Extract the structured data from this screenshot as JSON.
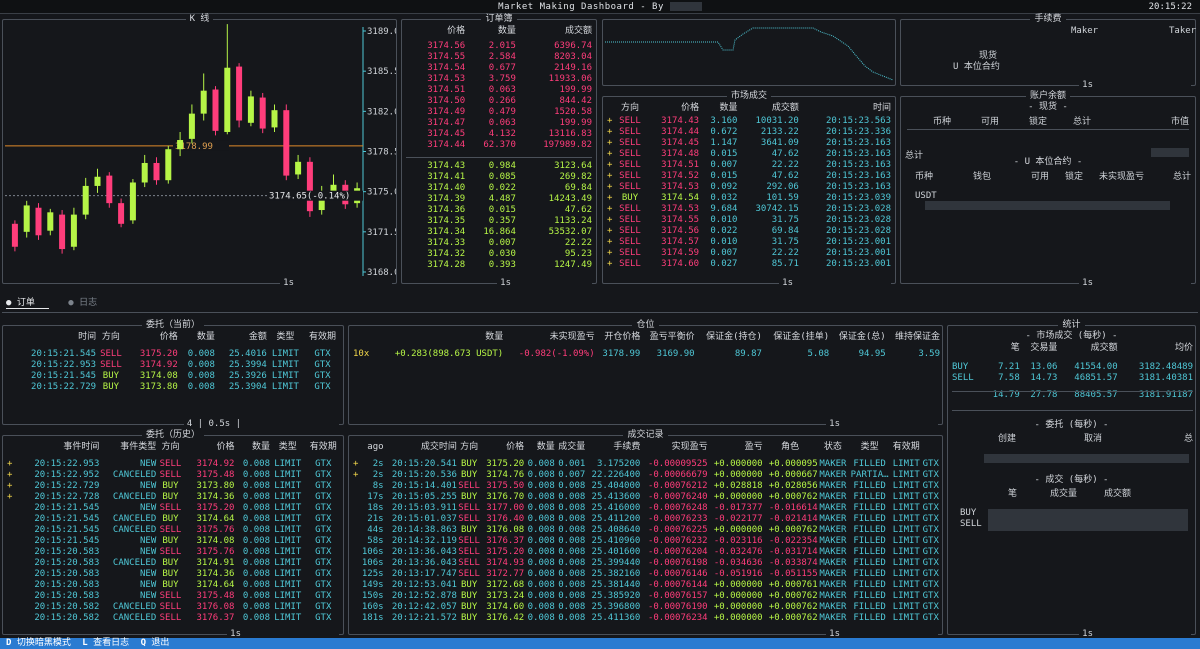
{
  "topbar": {
    "title": "Market Making Dashboard - By",
    "time": "20:15:22"
  },
  "kline": {
    "title": "K 线",
    "axis": [
      "3189.0",
      "3185.5",
      "3182.0",
      "3178.5",
      "3175.0",
      "3171.5",
      "3168.0"
    ],
    "hline_label": "3178.99",
    "last_label": "3174.65(-0.14%)",
    "interval": "1s",
    "ymin": 3168.0,
    "ymax": 3189.0,
    "candles": [
      [
        3172.2,
        3170.2,
        3172.5,
        3169.8
      ],
      [
        3171.5,
        3173.8,
        3174.2,
        3171.0
      ],
      [
        3173.6,
        3171.2,
        3174.0,
        3170.8
      ],
      [
        3171.6,
        3173.2,
        3173.5,
        3171.2
      ],
      [
        3173.0,
        3170.0,
        3173.4,
        3169.6
      ],
      [
        3170.2,
        3173.0,
        3173.6,
        3169.9
      ],
      [
        3173.0,
        3175.5,
        3176.2,
        3172.6
      ],
      [
        3175.5,
        3176.3,
        3177.0,
        3174.9
      ],
      [
        3176.4,
        3174.0,
        3176.7,
        3173.6
      ],
      [
        3174.0,
        3172.2,
        3174.4,
        3171.9
      ],
      [
        3172.5,
        3175.8,
        3176.1,
        3172.2
      ],
      [
        3175.8,
        3177.5,
        3178.2,
        3175.4
      ],
      [
        3177.5,
        3176.0,
        3178.0,
        3175.6
      ],
      [
        3176.0,
        3178.7,
        3179.0,
        3175.7
      ],
      [
        3178.7,
        3179.5,
        3180.2,
        3178.1
      ],
      [
        3179.6,
        3181.8,
        3182.6,
        3179.2
      ],
      [
        3181.8,
        3183.8,
        3185.3,
        3181.2
      ],
      [
        3183.9,
        3180.3,
        3184.2,
        3179.9
      ],
      [
        3180.2,
        3185.8,
        3189.6,
        3180.0
      ],
      [
        3185.9,
        3181.2,
        3186.2,
        3180.6
      ],
      [
        3181.0,
        3183.3,
        3183.8,
        3180.7
      ],
      [
        3183.2,
        3180.5,
        3183.6,
        3180.1
      ],
      [
        3180.6,
        3182.1,
        3182.6,
        3180.2
      ],
      [
        3182.1,
        3176.4,
        3182.6,
        3176.0
      ],
      [
        3176.5,
        3177.6,
        3178.2,
        3176.1
      ],
      [
        3177.6,
        3173.3,
        3178.0,
        3172.8
      ],
      [
        3173.4,
        3174.9,
        3175.5,
        3173.0
      ],
      [
        3174.9,
        3175.6,
        3176.5,
        3174.4
      ],
      [
        3175.6,
        3173.9,
        3176.0,
        3173.5
      ],
      [
        3174.0,
        3175.3,
        3175.8,
        3173.6
      ]
    ]
  },
  "orderbook": {
    "title": "订单簿",
    "headers": [
      "价格",
      "数量",
      "成交额"
    ],
    "asks": [
      [
        "3174.56",
        "2.015",
        "6396.74"
      ],
      [
        "3174.55",
        "2.584",
        "8203.04"
      ],
      [
        "3174.54",
        "0.677",
        "2149.16"
      ],
      [
        "3174.53",
        "3.759",
        "11933.06"
      ],
      [
        "3174.51",
        "0.063",
        "199.99"
      ],
      [
        "3174.50",
        "0.266",
        "844.42"
      ],
      [
        "3174.49",
        "0.479",
        "1520.58"
      ],
      [
        "3174.47",
        "0.063",
        "199.99"
      ],
      [
        "3174.45",
        "4.132",
        "13116.83"
      ],
      [
        "3174.44",
        "62.370",
        "197989.82"
      ]
    ],
    "bids": [
      [
        "3174.43",
        "0.984",
        "3123.64"
      ],
      [
        "3174.41",
        "0.085",
        "269.82"
      ],
      [
        "3174.40",
        "0.022",
        "69.84"
      ],
      [
        "3174.39",
        "4.487",
        "14243.49"
      ],
      [
        "3174.36",
        "0.015",
        "47.62"
      ],
      [
        "3174.35",
        "0.357",
        "1133.24"
      ],
      [
        "3174.34",
        "16.864",
        "53532.07"
      ],
      [
        "3174.33",
        "0.007",
        "22.22"
      ],
      [
        "3174.32",
        "0.030",
        "95.23"
      ],
      [
        "3174.28",
        "0.393",
        "1247.49"
      ]
    ],
    "interval": "1s"
  },
  "spark": {
    "values": [
      3174.65,
      3174.65,
      3174.65,
      3174.65,
      3174.65,
      3174.65,
      3174.65,
      3174.65,
      3174.65,
      3174.65,
      3174.65,
      3174.65,
      3174.65,
      3174.65,
      3174.65,
      3174.65,
      3174.65,
      3174.65,
      3174.65,
      3174.65,
      3174.65,
      3174.65,
      3174.65,
      3174.65,
      3174.65,
      3174.65,
      3174.65,
      3174.65,
      3174.65,
      3174.65,
      3174.65,
      3174.65,
      3174.65,
      3174.65,
      3174.65,
      3174.65,
      3174.65,
      3174.65,
      3174.65,
      3174.65,
      3174.65,
      3174.65,
      3174.65,
      3174.65,
      3174.65,
      3174.65,
      3174.65,
      3174.65,
      3174.65,
      3174.65,
      3174.65,
      3174.65,
      3174.65,
      3174.65,
      3174.65,
      3174.65,
      3174.65,
      3174.65,
      3174.65,
      3174.65,
      3174.65,
      3174.65,
      3174.65,
      3174.65,
      3174.65,
      3174.65,
      3174.65,
      3174.65,
      3174.65,
      3174.65,
      3174.65,
      3174.65,
      3174.65,
      3174.65,
      3174.65,
      3174.65,
      3174.65,
      3174.65,
      3174.65,
      3174.65,
      3174.65,
      3174.65,
      3174.65,
      3174.65,
      3174.65,
      3174.65,
      3174.65,
      3174.65,
      3174.65,
      3174.65,
      3174.65,
      3174.65,
      3174.65,
      3174.65,
      3174.65,
      3174.65,
      3174.65,
      3174.65,
      3174.65,
      3174.65,
      3174.65,
      3174.65,
      3174.65,
      3174.65,
      3174.65,
      3174.65,
      3174.65,
      3174.65,
      3174.65,
      3174.65,
      3174.65,
      3174.65,
      3174.65,
      3174.65,
      3174.65,
      3174.65,
      3174.65,
      3174.65,
      3174.65,
      3174.65,
      3174.65,
      3174.65,
      3174.65,
      3174.65,
      3174.65,
      3174.65,
      3174.65,
      3174.65,
      3174.65,
      3174.65,
      3174.65,
      3174.65,
      3174.65,
      3174.65,
      3174.65,
      3174.65,
      3174.65,
      3174.65,
      3174.65,
      3174.65,
      3174.65,
      3174.65,
      3174.65,
      3174.65,
      3174.65,
      3174.65,
      3174.65,
      3174.65,
      3174.65,
      3174.65,
      3174.65,
      3174.65,
      3174.65,
      3174.65,
      3174.65,
      3174.65,
      3174.65,
      3174.65,
      3174.65,
      3174.65,
      3174.65,
      3174.65,
      3174.65,
      3174.65,
      3174.65,
      3174.65,
      3174.65,
      3174.65,
      3174.65,
      3174.65,
      3174.65,
      3174.65,
      3174.65,
      3174.65,
      3174.65,
      3174.65,
      3174.65,
      3174.65,
      3174.65,
      3174.65,
      3174.65,
      3174.65,
      3174.65,
      3174.65,
      3174.65,
      3174.65,
      3174.65,
      3174.65,
      3174.65,
      3174.65,
      3174.65,
      3174.65,
      3174.65,
      3174.65,
      3174.65,
      3174.65,
      3174.65,
      3174.65,
      3174.65,
      3174.65,
      3174.65,
      3174.65,
      3174.65,
      3174.65,
      3174.65,
      3174.65,
      3174.65,
      3174.65,
      3174.65,
      3174.65,
      3174.65,
      3174.65,
      3174.65,
      3174.65,
      3174.65,
      3174.65,
      3174.65,
      3174.65,
      3174.65,
      3174.65,
      3174.65,
      3174.65,
      3174.65,
      3174.65,
      3174.65,
      3174.65,
      3174.65,
      3174.65,
      3174.65,
      3174.65,
      3174.65,
      3174.65,
      3174.65,
      3174.65,
      3174.65,
      3174.65,
      3174.65,
      3174.65,
      3174.65,
      3174.65,
      3174.65,
      3174.65,
      3174.65,
      3174.65,
      3174.65,
      3174.65,
      3174.65,
      3174.65,
      3174.65,
      3174.65,
      3174.65,
      3174.65,
      3174.65,
      3174.65,
      3174.65
    ]
  },
  "trades": {
    "title": "市场成交",
    "headers": [
      "方向",
      "价格",
      "数量",
      "成交额",
      "时间"
    ],
    "rows": [
      [
        "SELL",
        "3174.43",
        "3.160",
        "10031.20",
        "20:15:23.563"
      ],
      [
        "SELL",
        "3174.44",
        "0.672",
        "2133.22",
        "20:15:23.336"
      ],
      [
        "SELL",
        "3174.45",
        "1.147",
        "3641.09",
        "20:15:23.163"
      ],
      [
        "SELL",
        "3174.48",
        "0.015",
        "47.62",
        "20:15:23.163"
      ],
      [
        "SELL",
        "3174.51",
        "0.007",
        "22.22",
        "20:15:23.163"
      ],
      [
        "SELL",
        "3174.52",
        "0.015",
        "47.62",
        "20:15:23.163"
      ],
      [
        "SELL",
        "3174.53",
        "0.092",
        "292.06",
        "20:15:23.163"
      ],
      [
        "BUY",
        "3174.54",
        "0.032",
        "101.59",
        "20:15:23.039"
      ],
      [
        "SELL",
        "3174.53",
        "9.684",
        "30742.15",
        "20:15:23.028"
      ],
      [
        "SELL",
        "3174.55",
        "0.010",
        "31.75",
        "20:15:23.028"
      ],
      [
        "SELL",
        "3174.56",
        "0.022",
        "69.84",
        "20:15:23.028"
      ],
      [
        "SELL",
        "3174.57",
        "0.010",
        "31.75",
        "20:15:23.001"
      ],
      [
        "SELL",
        "3174.59",
        "0.007",
        "22.22",
        "20:15:23.001"
      ],
      [
        "SELL",
        "3174.60",
        "0.027",
        "85.71",
        "20:15:23.001"
      ]
    ],
    "interval": "1s"
  },
  "fees": {
    "title": "手续费",
    "headers": [
      "Maker",
      "Taker"
    ],
    "rows": [
      "现货",
      "U 本位合约"
    ],
    "interval": "1s"
  },
  "balance": {
    "title": "账户余额",
    "spot_title": "- 现货 -",
    "spot_headers": [
      "币种",
      "可用",
      "锁定",
      "总计",
      "市值"
    ],
    "total_label": "总计",
    "futures_title": "- U 本位合约 -",
    "futures_headers": [
      "币种",
      "钱包",
      "可用",
      "锁定",
      "未实现盈亏",
      "总计"
    ],
    "futures_rows": [
      [
        "USDT"
      ]
    ],
    "interval": "1s"
  },
  "tabs": {
    "orders": "订单",
    "logs": "日志"
  },
  "open_orders": {
    "title": "委托（当前）",
    "headers": [
      "时间",
      "方向",
      "价格",
      "数量",
      "金额",
      "类型",
      "有效期"
    ],
    "rows": [
      [
        "20:15:21.545",
        "SELL",
        "3175.20",
        "0.008",
        "25.4016",
        "LIMIT",
        "GTX"
      ],
      [
        "20:15:22.953",
        "SELL",
        "3174.92",
        "0.008",
        "25.3994",
        "LIMIT",
        "GTX"
      ],
      [
        "20:15:21.545",
        "BUY",
        "3174.08",
        "0.008",
        "25.3926",
        "LIMIT",
        "GTX"
      ],
      [
        "20:15:22.729",
        "BUY",
        "3173.80",
        "0.008",
        "25.3904",
        "LIMIT",
        "GTX"
      ]
    ],
    "footer": "4 | 0.5s |"
  },
  "position": {
    "title": "仓位",
    "headers": [
      "数量",
      "未实现盈亏",
      "开仓价格",
      "盈亏平衡价",
      "保证金(持仓)",
      "保证金(挂单)",
      "保证金(总)",
      "维持保证金"
    ],
    "row": [
      "10x",
      "+0.283(898.673 USDT)",
      "-0.982(-1.09%)",
      "3178.99",
      "3169.90",
      "89.87",
      "5.08",
      "94.95",
      "3.59"
    ],
    "interval": "1s"
  },
  "stats": {
    "title": "统计",
    "market_title": "- 市场成交 (每秒) -",
    "market_headers": [
      "笔",
      "交易量",
      "成交额",
      "均价"
    ],
    "market_rows": [
      [
        "BUY",
        "7.21",
        "13.06",
        "41554.00",
        "3182.48489"
      ],
      [
        "SELL",
        "7.58",
        "14.73",
        "46851.57",
        "3181.40381"
      ],
      [
        "",
        "14.79",
        "27.78",
        "88405.57",
        "3181.91187"
      ]
    ],
    "orders_title": "- 委托 (每秒) -",
    "orders_headers": [
      "创建",
      "取消",
      "总"
    ],
    "fills_title": "- 成交 (每秒) -",
    "fills_headers": [
      "笔",
      "成交量",
      "成交额"
    ],
    "fills_rows": [
      "BUY",
      "SELL"
    ],
    "interval": "1s"
  },
  "order_history": {
    "title": "委托（历史）",
    "headers": [
      "事件时间",
      "事件类型",
      "方向",
      "价格",
      "数量",
      "类型",
      "有效期"
    ],
    "rows": [
      [
        "+",
        "20:15:22.953",
        "NEW",
        "SELL",
        "3174.92",
        "0.008",
        "LIMIT",
        "GTX"
      ],
      [
        "+",
        "20:15:22.952",
        "CANCELED",
        "SELL",
        "3175.48",
        "0.008",
        "LIMIT",
        "GTX"
      ],
      [
        "+",
        "20:15:22.729",
        "NEW",
        "BUY",
        "3173.80",
        "0.008",
        "LIMIT",
        "GTX"
      ],
      [
        "+",
        "20:15:22.728",
        "CANCELED",
        "BUY",
        "3174.36",
        "0.008",
        "LIMIT",
        "GTX"
      ],
      [
        "",
        "20:15:21.545",
        "NEW",
        "SELL",
        "3175.20",
        "0.008",
        "LIMIT",
        "GTX"
      ],
      [
        "",
        "20:15:21.545",
        "CANCELED",
        "BUY",
        "3174.64",
        "0.008",
        "LIMIT",
        "GTX"
      ],
      [
        "",
        "20:15:21.545",
        "CANCELED",
        "SELL",
        "3175.76",
        "0.008",
        "LIMIT",
        "GTX"
      ],
      [
        "",
        "20:15:21.545",
        "NEW",
        "BUY",
        "3174.08",
        "0.008",
        "LIMIT",
        "GTX"
      ],
      [
        "",
        "20:15:20.583",
        "NEW",
        "SELL",
        "3175.76",
        "0.008",
        "LIMIT",
        "GTX"
      ],
      [
        "",
        "20:15:20.583",
        "CANCELED",
        "BUY",
        "3174.91",
        "0.008",
        "LIMIT",
        "GTX"
      ],
      [
        "",
        "20:15:20.583",
        "NEW",
        "BUY",
        "3174.36",
        "0.008",
        "LIMIT",
        "GTX"
      ],
      [
        "",
        "20:15:20.583",
        "NEW",
        "BUY",
        "3174.64",
        "0.008",
        "LIMIT",
        "GTX"
      ],
      [
        "",
        "20:15:20.583",
        "NEW",
        "SELL",
        "3175.48",
        "0.008",
        "LIMIT",
        "GTX"
      ],
      [
        "",
        "20:15:20.582",
        "CANCELED",
        "SELL",
        "3176.08",
        "0.008",
        "LIMIT",
        "GTX"
      ],
      [
        "",
        "20:15:20.582",
        "CANCELED",
        "SELL",
        "3176.37",
        "0.008",
        "LIMIT",
        "GTX"
      ]
    ],
    "interval": "1s"
  },
  "fills": {
    "title": "成交记录",
    "headers": [
      "ago",
      "成交时间",
      "方向",
      "价格",
      "数量",
      "成交量",
      "手续费",
      "实现盈亏",
      "盈亏",
      "角色",
      "状态",
      "类型",
      "有效期"
    ],
    "rows": [
      [
        "+",
        "2s",
        "20:15:20.541",
        "BUY",
        "3175.20",
        "0.008",
        "0.001",
        "3.175200",
        "-0.00009525",
        "+0.000000",
        "+0.000095",
        "MAKER",
        "FILLED",
        "LIMIT",
        "GTX"
      ],
      [
        "+",
        "2s",
        "20:15:20.536",
        "BUY",
        "3174.76",
        "0.008",
        "0.007",
        "22.226400",
        "-0.00066679",
        "+0.000000",
        "+0.000667",
        "MAKER",
        "PARTIA…",
        "LIMIT",
        "GTX"
      ],
      [
        "",
        "8s",
        "20:15:14.401",
        "SELL",
        "3175.50",
        "0.008",
        "0.008",
        "25.404000",
        "-0.00076212",
        "+0.028818",
        "+0.028056",
        "MAKER",
        "FILLED",
        "LIMIT",
        "GTX"
      ],
      [
        "",
        "17s",
        "20:15:05.255",
        "BUY",
        "3176.70",
        "0.008",
        "0.008",
        "25.413600",
        "-0.00076240",
        "+0.000000",
        "+0.000762",
        "MAKER",
        "FILLED",
        "LIMIT",
        "GTX"
      ],
      [
        "",
        "18s",
        "20:15:03.911",
        "SELL",
        "3177.00",
        "0.008",
        "0.008",
        "25.416000",
        "-0.00076248",
        "-0.017377",
        "-0.016614",
        "MAKER",
        "FILLED",
        "LIMIT",
        "GTX"
      ],
      [
        "",
        "21s",
        "20:15:01.037",
        "SELL",
        "3176.40",
        "0.008",
        "0.008",
        "25.411200",
        "-0.00076233",
        "-0.022177",
        "-0.021414",
        "MAKER",
        "FILLED",
        "LIMIT",
        "GTX"
      ],
      [
        "",
        "44s",
        "20:14:38.863",
        "BUY",
        "3176.08",
        "0.008",
        "0.008",
        "25.408640",
        "-0.00076225",
        "+0.000000",
        "+0.000762",
        "MAKER",
        "FILLED",
        "LIMIT",
        "GTX"
      ],
      [
        "",
        "58s",
        "20:14:32.119",
        "SELL",
        "3176.37",
        "0.008",
        "0.008",
        "25.410960",
        "-0.00076232",
        "-0.023116",
        "-0.022354",
        "MAKER",
        "FILLED",
        "LIMIT",
        "GTX"
      ],
      [
        "",
        "106s",
        "20:13:36.043",
        "SELL",
        "3175.20",
        "0.008",
        "0.008",
        "25.401600",
        "-0.00076204",
        "-0.032476",
        "-0.031714",
        "MAKER",
        "FILLED",
        "LIMIT",
        "GTX"
      ],
      [
        "",
        "106s",
        "20:13:36.043",
        "SELL",
        "3174.93",
        "0.008",
        "0.008",
        "25.399440",
        "-0.00076198",
        "-0.034636",
        "-0.033874",
        "MAKER",
        "FILLED",
        "LIMIT",
        "GTX"
      ],
      [
        "",
        "125s",
        "20:13:17.747",
        "SELL",
        "3172.77",
        "0.008",
        "0.008",
        "25.382160",
        "-0.00076146",
        "-0.051916",
        "-0.051155",
        "MAKER",
        "FILLED",
        "LIMIT",
        "GTX"
      ],
      [
        "",
        "149s",
        "20:12:53.041",
        "BUY",
        "3172.68",
        "0.008",
        "0.008",
        "25.381440",
        "-0.00076144",
        "+0.000000",
        "+0.000761",
        "MAKER",
        "FILLED",
        "LIMIT",
        "GTX"
      ],
      [
        "",
        "150s",
        "20:12:52.878",
        "BUY",
        "3173.24",
        "0.008",
        "0.008",
        "25.385920",
        "-0.00076157",
        "+0.000000",
        "+0.000762",
        "MAKER",
        "FILLED",
        "LIMIT",
        "GTX"
      ],
      [
        "",
        "160s",
        "20:12:42.057",
        "BUY",
        "3174.60",
        "0.008",
        "0.008",
        "25.396800",
        "-0.00076190",
        "+0.000000",
        "+0.000762",
        "MAKER",
        "FILLED",
        "LIMIT",
        "GTX"
      ],
      [
        "",
        "181s",
        "20:12:21.572",
        "BUY",
        "3176.42",
        "0.008",
        "0.008",
        "25.411360",
        "-0.00076234",
        "+0.000000",
        "+0.000762",
        "MAKER",
        "FILLED",
        "LIMIT",
        "GTX"
      ]
    ],
    "interval": "1s"
  },
  "statusbar": {
    "items": [
      {
        "key": "D",
        "label": "切换暗黑模式"
      },
      {
        "key": "L",
        "label": "查看日志"
      },
      {
        "key": "Q",
        "label": "退出"
      }
    ]
  },
  "colors": {
    "up": "#b6f547",
    "down": "#ff3d7b",
    "accent": "#4fc7d6",
    "border": "#4a5059",
    "status": "#2a7bd1"
  }
}
